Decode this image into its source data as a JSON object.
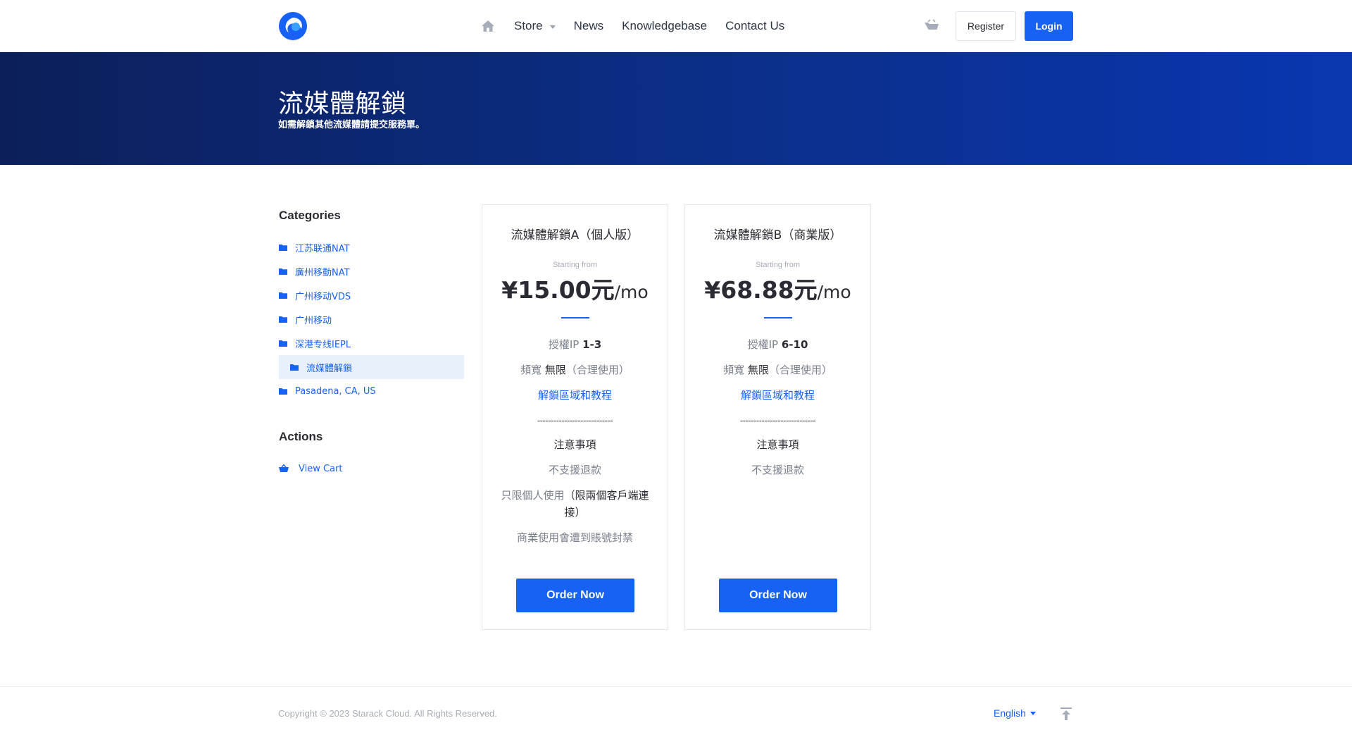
{
  "header": {
    "logo_icon": "brand-logo-icon",
    "nav": {
      "home_icon": "home-icon",
      "store_label": "Store",
      "news_label": "News",
      "kb_label": "Knowledgebase",
      "contact_label": "Contact Us"
    },
    "cart_icon": "cart-icon",
    "register_label": "Register",
    "login_label": "Login"
  },
  "banner": {
    "title": "流媒體解鎖",
    "subtitle": "如需解鎖其他流媒體請提交服務單。"
  },
  "sidebar": {
    "categories_heading": "Categories",
    "categories": [
      {
        "label": "江苏联通NAT",
        "icon": "folder-icon"
      },
      {
        "label": "廣州移動NAT",
        "icon": "folder-icon"
      },
      {
        "label": "广州移动VDS",
        "icon": "folder-icon"
      },
      {
        "label": "广州移动",
        "icon": "folder-icon"
      },
      {
        "label": "深港专线IEPL",
        "icon": "folder-icon"
      },
      {
        "label": "流媒體解鎖",
        "icon": "folder-icon",
        "active": true
      },
      {
        "label": "Pasadena, CA, US",
        "icon": "folder-icon"
      }
    ],
    "actions_heading": "Actions",
    "actions": [
      {
        "label": "View Cart",
        "icon": "basket-icon"
      }
    ]
  },
  "products": [
    {
      "title": "流媒體解鎖A（個人版）",
      "starting_from": "Starting from",
      "price": "¥15.00元",
      "cycle": "/mo",
      "ip_label": "授權IP",
      "ip_value": "1-3",
      "bw_label": "頻寬",
      "bw_value": "無限",
      "bw_note": "（合理使用）",
      "link": "解鎖區域和教程",
      "dashes": "----------------------------",
      "notes_heading": "注意事項",
      "notes": [
        "不支援退款"
      ],
      "note_personal_a": "只限個人使用",
      "note_personal_b": "（限兩個客戶端連接）",
      "note_ban": "商業使用會遭到賬號封禁",
      "order_label": "Order Now"
    },
    {
      "title": "流媒體解鎖B（商業版）",
      "starting_from": "Starting from",
      "price": "¥68.88元",
      "cycle": "/mo",
      "ip_label": "授權IP",
      "ip_value": "6-10",
      "bw_label": "頻寬",
      "bw_value": "無限",
      "bw_note": "（合理使用）",
      "link": "解鎖區域和教程",
      "dashes": "----------------------------",
      "notes_heading": "注意事項",
      "notes": [
        "不支援退款"
      ],
      "order_label": "Order Now"
    }
  ],
  "footer": {
    "copyright": "Copyright © 2023 Starack Cloud. All Rights Reserved.",
    "language": "English",
    "back_to_top_icon": "back-to-top-icon"
  },
  "colors": {
    "accent": "#1762f5",
    "banner_start": "#0c1f5a",
    "banner_end": "#0a36b0",
    "active_bg": "#e8f0fb"
  }
}
